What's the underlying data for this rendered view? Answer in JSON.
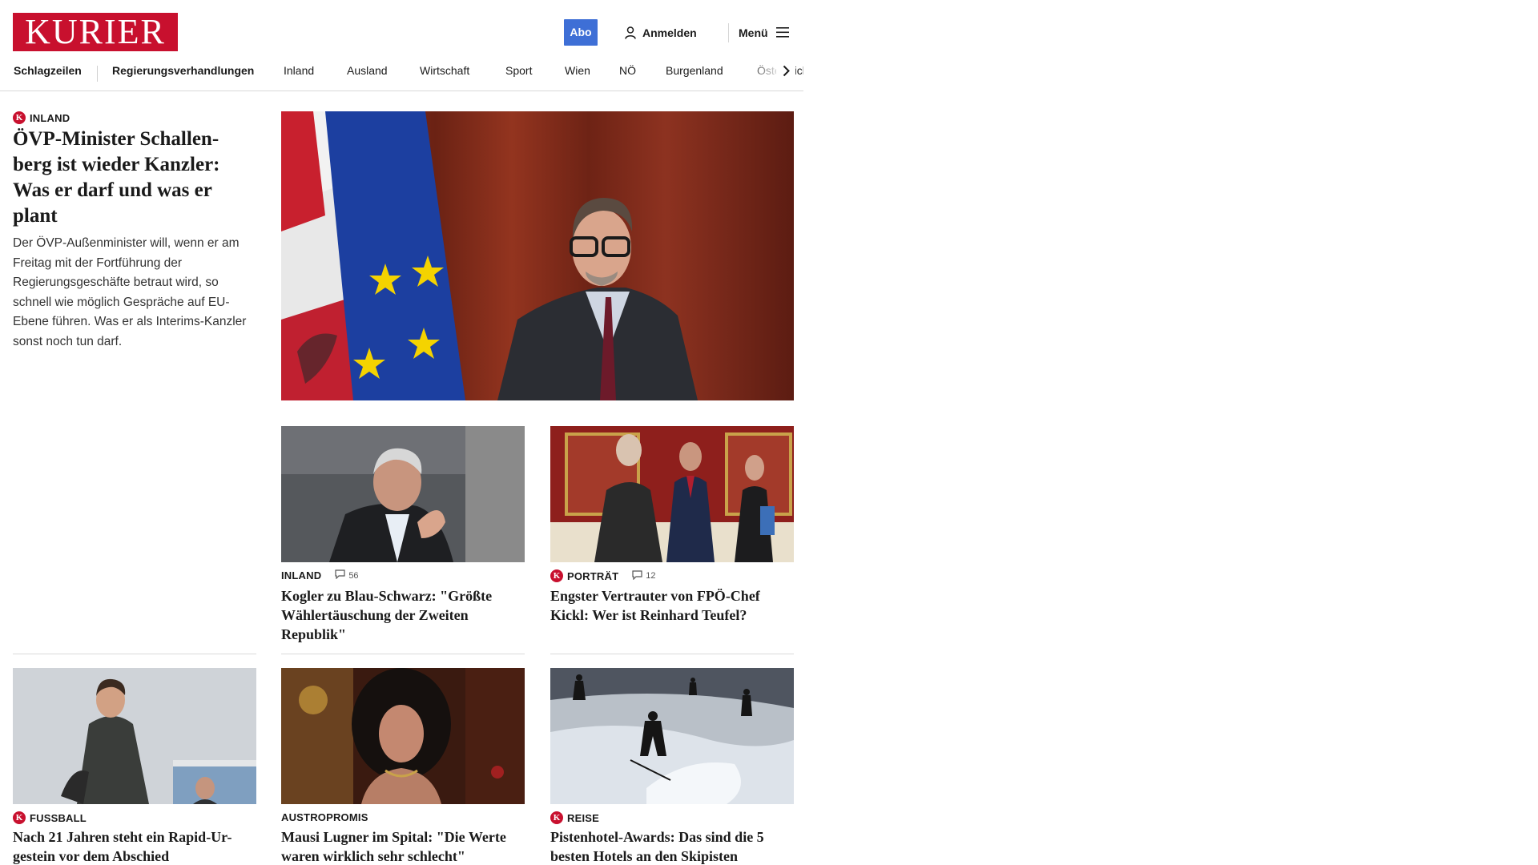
{
  "brand": {
    "logo_text": "KURIER",
    "accent_color": "#c8102e",
    "abo_color": "#3e6fd6"
  },
  "header": {
    "abo_label": "Abo",
    "login_label": "Anmelden",
    "menu_label": "Menü"
  },
  "nav": {
    "items": [
      {
        "label": "Schlagzeilen"
      },
      {
        "label": "Regierungsverhandlungen"
      },
      {
        "label": "Inland"
      },
      {
        "label": "Ausland"
      },
      {
        "label": "Wirtschaft"
      },
      {
        "label": "Sport"
      },
      {
        "label": "Wien"
      },
      {
        "label": "NÖ"
      },
      {
        "label": "Burgenland"
      },
      {
        "label": "Österreich"
      }
    ]
  },
  "lead": {
    "section": "INLAND",
    "title": "ÖVP-Minister Schallen-berg ist wieder Kanzler: Was er darf und was er plant",
    "teaser": "Der ÖVP-Außenminister will, wenn er am Freitag mit der Fortführung der Regierungsgeschäfte betraut wird, so schnell wie möglich Gespräche auf EU-Ebene führen. Was er als Interims-Kanzler sonst noch tun darf."
  },
  "cards": [
    {
      "section": "INLAND",
      "comments": "56",
      "title": "Kogler zu Blau-Schwarz: \"Größte Wählertäuschung der Zweiten Republik\""
    },
    {
      "section": "PORTRÄT",
      "comments": "12",
      "title": "Engster Vertrauter von FPÖ-Chef Kickl: Wer ist Reinhard Teufel?"
    },
    {
      "section": "FUSSBALL",
      "title": "Nach 21 Jahren steht ein Rapid-Ur-gestein vor dem Abschied"
    },
    {
      "section": "AUSTROPROMIS",
      "title": "Mausi Lugner im Spital: \"Die Werte waren wirklich sehr schlecht\""
    },
    {
      "section": "REISE",
      "title": "Pistenhotel-Awards: Das sind die 5 besten Hotels an den Skipisten"
    }
  ],
  "icons": {
    "login": "user-icon",
    "menu": "hamburger-icon",
    "nav_next": "chevron-right-icon",
    "comment": "comment-icon",
    "premium": "kurier-k-badge"
  }
}
